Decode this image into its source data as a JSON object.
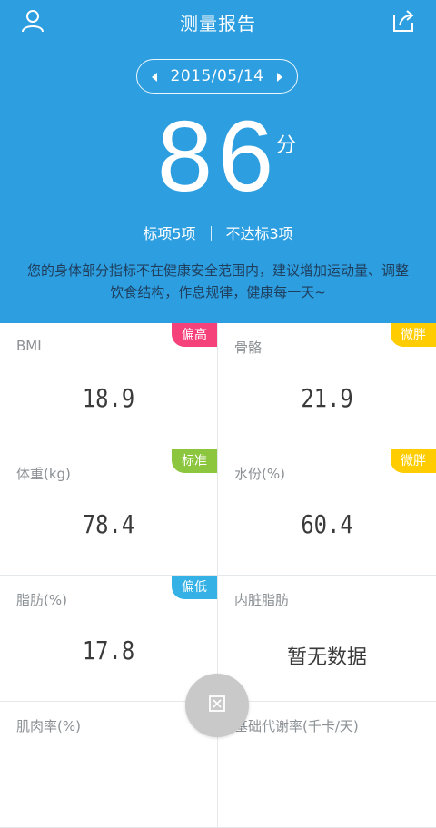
{
  "header": {
    "title": "测量报告"
  },
  "date": "2015/05/14",
  "score": {
    "value": "86",
    "unit": "分"
  },
  "stats": {
    "standard": "标项5项",
    "below": "不达标3项"
  },
  "advice": "您的身体部分指标不在健康安全范围内，建议增加运动量、调整饮食结构，作息规律，健康每一天~",
  "colors": {
    "header_bg": "#2d9ee0",
    "badge_high": "#f5427a",
    "badge_heavy": "#ffcc00",
    "badge_standard": "#8cc63f",
    "badge_low": "#35b1e6"
  },
  "metrics": [
    {
      "label": "BMI",
      "value": "18.9",
      "badge": "偏高",
      "badge_color": "#f5427a"
    },
    {
      "label": "骨骼",
      "value": "21.9",
      "badge": "微胖",
      "badge_color": "#ffcc00"
    },
    {
      "label": "体重(kg)",
      "value": "78.4",
      "badge": "标准",
      "badge_color": "#8cc63f"
    },
    {
      "label": "水份(%)",
      "value": "60.4",
      "badge": "微胖",
      "badge_color": "#ffcc00"
    },
    {
      "label": "脂肪(%)",
      "value": "17.8",
      "badge": "偏低",
      "badge_color": "#35b1e6"
    },
    {
      "label": "内脏脂肪",
      "value": "暂无数据",
      "badge": "",
      "badge_color": ""
    },
    {
      "label": "肌肉率(%)",
      "value": "",
      "badge": "",
      "badge_color": ""
    },
    {
      "label": "基础代谢率(千卡/天)",
      "value": "",
      "badge": "",
      "badge_color": ""
    }
  ],
  "icons": {
    "user": "user-icon",
    "share": "share-icon",
    "prev": "prev-arrow-icon",
    "next": "next-arrow-icon",
    "fab": "collapse-icon"
  }
}
